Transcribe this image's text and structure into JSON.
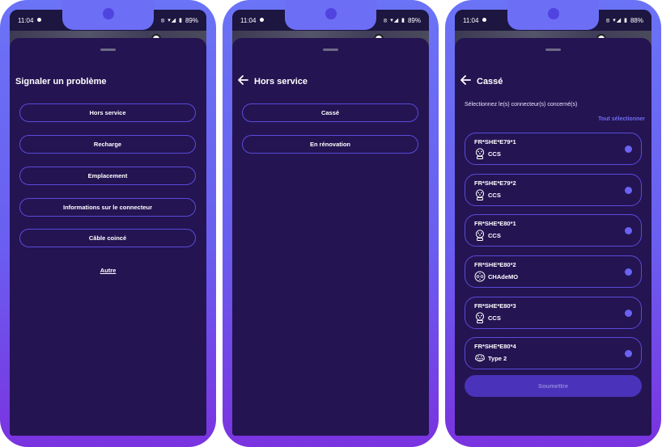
{
  "colors": {
    "sheet_bg": "#241452",
    "accent": "#6a63f3",
    "border": "#5a4bd9",
    "frame_top": "#6b73f6",
    "frame_bottom": "#7a33df"
  },
  "screens": [
    {
      "status": {
        "time": "11:04",
        "battery": "89%"
      },
      "title": "Signaler un problème",
      "options": [
        "Hors service",
        "Recharge",
        "Emplacement",
        "Informations sur le connecteur",
        "Câble coincé"
      ],
      "other_link": "Autre"
    },
    {
      "status": {
        "time": "11:04",
        "battery": "89%"
      },
      "title": "Hors service",
      "back_icon": "arrow-left-icon",
      "options": [
        "Cassé",
        "En rénovation"
      ]
    },
    {
      "status": {
        "time": "11:04",
        "battery": "88%"
      },
      "title": "Cassé",
      "back_icon": "arrow-left-icon",
      "instruction": "Sélectionnez le(s) connecteur(s) concerné(s)",
      "select_all": "Tout sélectionner",
      "connectors": [
        {
          "id": "FR*SHE*E79*1",
          "type": "CCS",
          "icon": "ccs-plug-icon"
        },
        {
          "id": "FR*SHE*E79*2",
          "type": "CCS",
          "icon": "ccs-plug-icon"
        },
        {
          "id": "FR*SHE*E80*1",
          "type": "CCS",
          "icon": "ccs-plug-icon"
        },
        {
          "id": "FR*SHE*E80*2",
          "type": "CHAdeMO",
          "icon": "chademo-plug-icon"
        },
        {
          "id": "FR*SHE*E80*3",
          "type": "CCS",
          "icon": "ccs-plug-icon"
        },
        {
          "id": "FR*SHE*E80*4",
          "type": "Type 2",
          "icon": "type2-plug-icon"
        }
      ],
      "submit_label": "Soumettre"
    }
  ]
}
